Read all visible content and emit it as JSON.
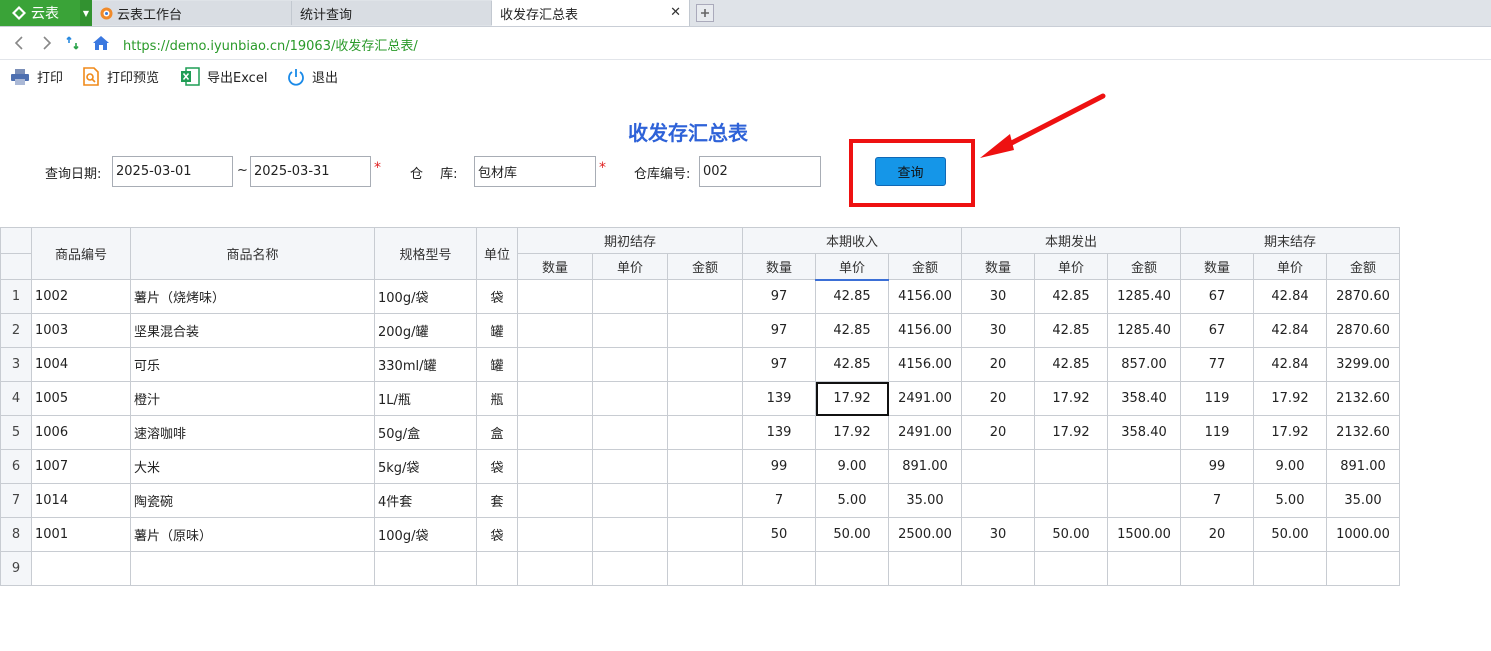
{
  "tabs": {
    "app_label": "云表",
    "items": [
      {
        "label": "云表工作台"
      },
      {
        "label": "统计查询"
      },
      {
        "label": "收发存汇总表"
      }
    ],
    "close_glyph": "✕"
  },
  "address": {
    "url": "https://demo.iyunbiao.cn/19063/收发存汇总表/"
  },
  "toolbar": {
    "print": "打印",
    "preview": "打印预览",
    "excel": "导出Excel",
    "exit": "退出"
  },
  "report": {
    "title": "收发存汇总表",
    "date_label": "查询日期:",
    "date_from": "2025-03-01",
    "tilde": "~",
    "date_to": "2025-03-31",
    "warehouse_label": "仓　 库:",
    "warehouse_value": "包材库",
    "warehouse_code_label": "仓库编号:",
    "warehouse_code_value": "002",
    "query_button": "查询",
    "required_mark": "*"
  },
  "table": {
    "fixed_headers": [
      "商品编号",
      "商品名称",
      "规格型号",
      "单位"
    ],
    "groups": [
      "期初结存",
      "本期收入",
      "本期发出",
      "期末结存"
    ],
    "sub_headers": [
      "数量",
      "单价",
      "金额"
    ],
    "rows": [
      {
        "no": "1",
        "code": "1002",
        "name": "薯片（烧烤味）",
        "spec": "100g/袋",
        "unit": "袋",
        "vals": [
          "",
          "",
          "",
          "97",
          "42.85",
          "4156.00",
          "30",
          "42.85",
          "1285.40",
          "67",
          "42.84",
          "2870.60"
        ]
      },
      {
        "no": "2",
        "code": "1003",
        "name": "坚果混合装",
        "spec": "200g/罐",
        "unit": "罐",
        "vals": [
          "",
          "",
          "",
          "97",
          "42.85",
          "4156.00",
          "30",
          "42.85",
          "1285.40",
          "67",
          "42.84",
          "2870.60"
        ]
      },
      {
        "no": "3",
        "code": "1004",
        "name": "可乐",
        "spec": "330ml/罐",
        "unit": "罐",
        "vals": [
          "",
          "",
          "",
          "97",
          "42.85",
          "4156.00",
          "20",
          "42.85",
          "857.00",
          "77",
          "42.84",
          "3299.00"
        ]
      },
      {
        "no": "4",
        "code": "1005",
        "name": "橙汁",
        "spec": "1L/瓶",
        "unit": "瓶",
        "vals": [
          "",
          "",
          "",
          "139",
          "17.92",
          "2491.00",
          "20",
          "17.92",
          "358.40",
          "119",
          "17.92",
          "2132.60"
        ]
      },
      {
        "no": "5",
        "code": "1006",
        "name": "速溶咖啡",
        "spec": "50g/盒",
        "unit": "盒",
        "vals": [
          "",
          "",
          "",
          "139",
          "17.92",
          "2491.00",
          "20",
          "17.92",
          "358.40",
          "119",
          "17.92",
          "2132.60"
        ]
      },
      {
        "no": "6",
        "code": "1007",
        "name": "大米",
        "spec": "5kg/袋",
        "unit": "袋",
        "vals": [
          "",
          "",
          "",
          "99",
          "9.00",
          "891.00",
          "",
          "",
          "",
          "99",
          "9.00",
          "891.00"
        ]
      },
      {
        "no": "7",
        "code": "1014",
        "name": "陶瓷碗",
        "spec": "4件套",
        "unit": "套",
        "vals": [
          "",
          "",
          "",
          "7",
          "5.00",
          "35.00",
          "",
          "",
          "",
          "7",
          "5.00",
          "35.00"
        ]
      },
      {
        "no": "8",
        "code": "1001",
        "name": "薯片（原味）",
        "spec": "100g/袋",
        "unit": "袋",
        "vals": [
          "",
          "",
          "",
          "50",
          "50.00",
          "2500.00",
          "30",
          "50.00",
          "1500.00",
          "20",
          "50.00",
          "1000.00"
        ]
      },
      {
        "no": "9",
        "code": "",
        "name": "",
        "spec": "",
        "unit": "",
        "vals": [
          "",
          "",
          "",
          "",
          "",
          "",
          "",
          "",
          "",
          "",
          "",
          ""
        ]
      }
    ]
  }
}
